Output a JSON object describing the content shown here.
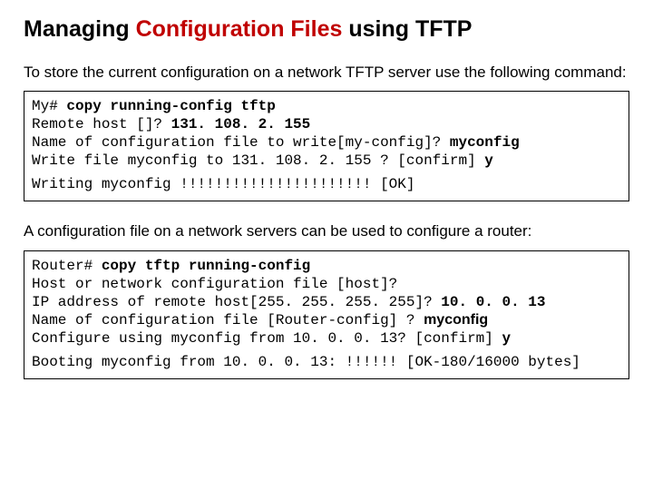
{
  "title": {
    "part1": "Managing ",
    "highlight": "Configuration Files",
    "part2": " using TFTP"
  },
  "intro1": "To store the current configuration on a network TFTP server use the following command:",
  "code1": {
    "l1a": "My# ",
    "l1b": "copy running-config tftp",
    "l2a": "Remote host []? ",
    "l2b": "131. 108. 2. 155",
    "l3a": "Name of configuration file to write[my-config]? ",
    "l3b": "myconfig",
    "l4a": "Write file myconfig to 131. 108. 2. 155 ? [confirm] ",
    "l4b": "y",
    "l5": "Writing myconfig !!!!!!!!!!!!!!!!!!!!!! [OK]"
  },
  "intro2": "A configuration file on a network servers can be used to configure a router:",
  "code2": {
    "l1a": "Router# ",
    "l1b": "copy tftp running-config",
    "l2": "Host or network configuration file [host]?",
    "l3a": "IP address of remote host[255. 255. 255. 255]? ",
    "l3b": "10. 0. 0. 13",
    "l4a": "Name of configuration file [Router-config] ? ",
    "l4b": "myconfig",
    "l5a": "Configure using myconfig from 10. 0. 0. 13? [confirm] ",
    "l5b": "y",
    "l6": "Booting myconfig from 10. 0. 0. 13: !!!!!! [OK-180/16000 bytes]"
  }
}
